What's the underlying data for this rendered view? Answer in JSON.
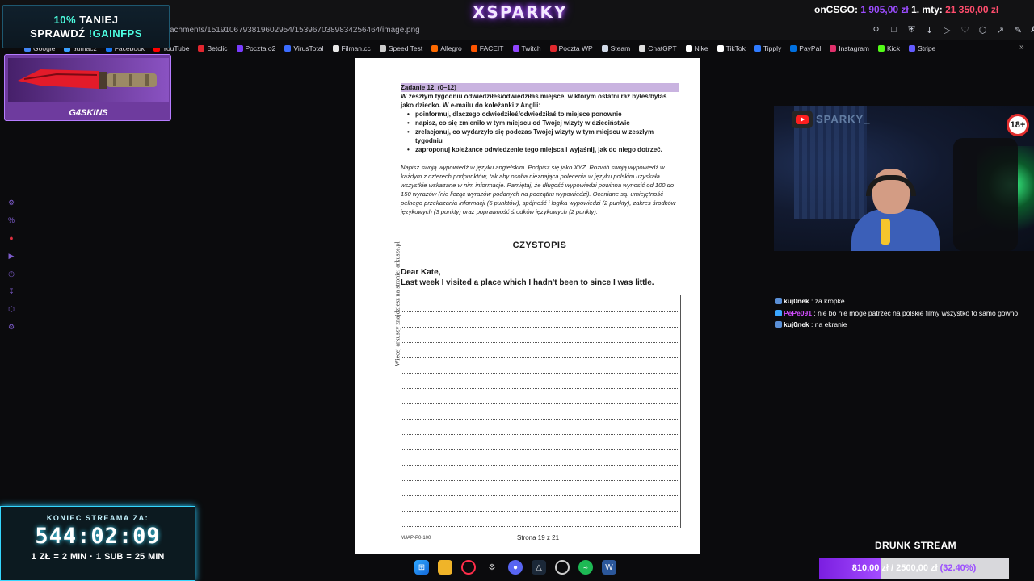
{
  "browser": {
    "url_fragment": "achments/1519106793819602954/1539670389834256464/image.png",
    "bookmarks": [
      "Google",
      "tłumacz",
      "Facebook",
      "YouTube",
      "Betclic",
      "Poczta o2",
      "VirusTotal",
      "Filman.cc",
      "Speed Test",
      "Allegro",
      "FACEIT",
      "Twitch",
      "Poczta WP",
      "Steam",
      "ChatGPT",
      "Nike",
      "TikTok",
      "Tipply",
      "PayPal",
      "Instagram",
      "Kick",
      "Stripe"
    ],
    "bookmark_colors": [
      "#4285f4",
      "#3aa0ff",
      "#1877f2",
      "#ff0000",
      "#e3262f",
      "#7a3cff",
      "#3b6cff",
      "#e8e8e8",
      "#cccccc",
      "#ff6a00",
      "#ff5500",
      "#9146ff",
      "#e0282d",
      "#cfd8e6",
      "#dddddd",
      "#ffffff",
      "#ffffff",
      "#2f7bff",
      "#0070e0",
      "#e1306c",
      "#53fc18",
      "#635bff"
    ],
    "toolbar_icons": [
      "pin-icon",
      "screenshot-icon",
      "shield-icon",
      "download-icon",
      "play-icon",
      "heart-icon",
      "extensions-icon",
      "share-icon",
      "edit-icon"
    ],
    "toolbar_ai_label": "AI"
  },
  "overlay": {
    "brand": "XSPARKY",
    "ticker": {
      "label1": "onCSGO:",
      "value1": "1 905,00 zł",
      "label2": "1. mty:",
      "value2": "21 350,00 zł"
    },
    "promo": {
      "line1_accent": "10%",
      "line1_rest": "TANIEJ",
      "line2_rest": "SPRAWDŹ",
      "line2_accent": "!GAINFPS"
    },
    "skins_brand": "G4SKINS",
    "countdown": {
      "label": "KONIEC STREAMA ZA:",
      "time": "544:02:09",
      "rates": "1 ZŁ = 2 MIN · 1 SUB = 25 MIN"
    },
    "drunk_label": "DRUNK STREAM",
    "goal": {
      "current": "810,00 zł",
      "target": "2500,00 zł",
      "percent_label": "(32.40%)",
      "fraction": 0.324
    },
    "age_badge": "18+",
    "cam_handle": "SPARKY_"
  },
  "document": {
    "side_text": "Więcej arkuszy znajdziesz na stronie: arkusze.pl",
    "task_title": "Zadanie 12. (0–12)",
    "task_intro": "W zeszłym tygodniu odwiedziłeś/odwiedziłaś miejsce, w którym ostatni raz byłeś/byłaś jako dziecko. W e-mailu do koleżanki z Anglii:",
    "bullets": [
      "poinformuj, dlaczego odwiedziłeś/odwiedziłaś to miejsce ponownie",
      "napisz, co się zmieniło w tym miejscu od Twojej wizyty w dzieciństwie",
      "zrelacjonuj, co wydarzyło się podczas Twojej wizyty w tym miejscu w zeszłym tygodniu",
      "zaproponuj koleżance odwiedzenie tego miejsca i wyjaśnij, jak do niego dotrzeć."
    ],
    "instructions": "Napisz swoją wypowiedź w języku angielskim. Podpisz się jako XYZ. Rozwiń swoją wypowiedź w każdym z czterech podpunktów, tak aby osoba nieznająca polecenia w języku polskim uzyskała wszystkie wskazane w nim informacje. Pamiętaj, że długość wypowiedzi powinna wynosić od 100 do 150 wyrazów (nie licząc wyrazów podanych na początku wypowiedzi). Oceniane są: umiejętność pełnego przekazania informacji (5 punktów), spójność i logika wypowiedzi (2 punkty), zakres środków językowych (3 punkty) oraz poprawność środków językowych (2 punkty).",
    "heading": "CZYSTOPIS",
    "greeting": "Dear Kate,",
    "first_line": "Last week I visited a place which I hadn't been to since I was little.",
    "footer_code": "MJAP-P0-100",
    "page_number": "Strona 19 z 21"
  },
  "chat": [
    {
      "user": "kuj0nek",
      "text": "za kropke",
      "color": "#ffffff"
    },
    {
      "user": "PePe091",
      "text": "nie bo nie moge patrzec na polskie filmy wszystko to samo gówno",
      "color": "#d24dff"
    },
    {
      "user": "kuj0nek",
      "text": "na ekranie",
      "color": "#ffffff"
    }
  ],
  "taskbar_icons": [
    "windows-start-icon",
    "file-explorer-icon",
    "opera-gx-icon",
    "steelseries-icon",
    "discord-icon",
    "steam-icon",
    "chrome-icon",
    "spotify-icon",
    "word-icon"
  ],
  "colors": {
    "accent": "#9b4dff",
    "cyan": "#35d7ff"
  }
}
